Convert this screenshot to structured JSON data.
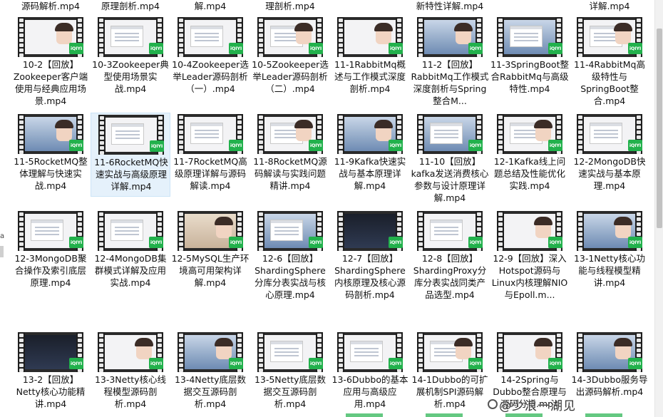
{
  "top_row": [
    "源码解析.mp4",
    "原理剖析.mp4",
    "解.mp4",
    "理剖析.mp4",
    "新特性详解.mp4",
    "详解.mp4"
  ],
  "rows": [
    {
      "tiles": [
        {
          "label": "10-2【回放】Zookeeper客户端使用与经典应用场景.mp4",
          "style": "face",
          "selected": false
        },
        {
          "label": "10-3Zookeeper典型使用场景实战.mp4",
          "style": "screen",
          "selected": false
        },
        {
          "label": "10-4Zookeeper选举Leader源码剖析（一）.mp4",
          "style": "screen",
          "selected": false
        },
        {
          "label": "10-5Zookeeper选举Leader源码剖析（二）.mp4",
          "style": "screen-face",
          "selected": false
        },
        {
          "label": "11-1RabbitMq概述与工作模式深度剖析.mp4",
          "style": "face",
          "selected": false
        },
        {
          "label": "11-2【回放】RabbitMq工作模式深度剖析与Spring整合M...",
          "style": "photo-face",
          "selected": false
        },
        {
          "label": "11-3SpringBoot整合RabbitMq与高级特性.mp4",
          "style": "photo",
          "selected": false
        },
        {
          "label": "11-4RabbitMq高级特性与SpringBoot整合.mp4",
          "style": "screen-face",
          "selected": false
        }
      ]
    },
    {
      "tiles": [
        {
          "label": "11-5RocketMQ整体理解与快速实战.mp4",
          "style": "photo-face",
          "selected": false
        },
        {
          "label": "11-6RocketMQ快速实战与高级原理详解.mp4",
          "style": "screen",
          "selected": true
        },
        {
          "label": "11-7RocketMQ高级原理详解与源码解读.mp4",
          "style": "screen",
          "selected": false
        },
        {
          "label": "11-8RocketMQ源码解读与实践问题精讲.mp4",
          "style": "screen-face",
          "selected": false
        },
        {
          "label": "11-9Kafka快速实战与基本原理详解.mp4",
          "style": "photo-face",
          "selected": false
        },
        {
          "label": "11-10【回放】kafka发送消费核心参数与设计原理详解.mp4",
          "style": "photo",
          "selected": false
        },
        {
          "label": "12-1Kafka线上问题总结及性能优化实践.mp4",
          "style": "screen-face",
          "selected": false
        },
        {
          "label": "12-2MongoDB快速实战与基本原理.mp4",
          "style": "screen",
          "selected": false
        }
      ]
    },
    {
      "tiles": [
        {
          "label": "12-3MongoDB聚合操作及索引底层原理.mp4",
          "style": "screen",
          "selected": false
        },
        {
          "label": "12-4MongoDB集群模式详解及应用实战.mp4",
          "style": "screen",
          "selected": false
        },
        {
          "label": "12-5MySQL生产环境高可用架构详解.mp4",
          "style": "warm-face",
          "selected": false
        },
        {
          "label": "12-6【回放】ShardingSphere分库分表实战与核心原理.mp4",
          "style": "photo",
          "selected": false
        },
        {
          "label": "12-7【回放】ShardingSphere内核原理及核心源码剖析.mp4",
          "style": "dark",
          "selected": false
        },
        {
          "label": "12-8【回放】ShardingProxy分库分表实战同类产品选型.mp4",
          "style": "screen",
          "selected": false
        },
        {
          "label": "12-9【回放】深入Hotspot源码与Linux内核理解NIO与Epoll.m...",
          "style": "face",
          "selected": false
        },
        {
          "label": "13-1Netty核心功能与线程模型精讲.mp4",
          "style": "photo-face",
          "selected": false
        }
      ]
    },
    {
      "tiles": [
        {
          "label": "13-2【回放】Netty核心功能精讲.mp4",
          "style": "dark",
          "selected": false
        },
        {
          "label": "13-3Netty核心线程模型源码剖析.mp4",
          "style": "face",
          "selected": false
        },
        {
          "label": "13-4Netty底层数据交互源码剖析.mp4",
          "style": "photo-face",
          "selected": false
        },
        {
          "label": "13-5Netty底层数据交互源码剖析.mp4",
          "style": "screen",
          "selected": false
        },
        {
          "label": "13-6Dubbo的基本应用与高级应用.mp4",
          "style": "screen",
          "selected": false
        },
        {
          "label": "14-1Dubbo的可扩展机制SPI源码解析.mp4",
          "style": "screen-face",
          "selected": false
        },
        {
          "label": "14-2Spring与Dubbo整合原理与源码分析.mp4",
          "style": "face",
          "selected": false
        },
        {
          "label": "14-3Dubbo服务导出源码解析.mp4",
          "style": "photo-face",
          "selected": false
        }
      ]
    }
  ],
  "badge_text": "iQIYI",
  "watermark": "@少浪一湖见",
  "colors": {
    "badge": "#22b14c",
    "selected_bg": "#e5f1fb",
    "text": "#111111"
  }
}
